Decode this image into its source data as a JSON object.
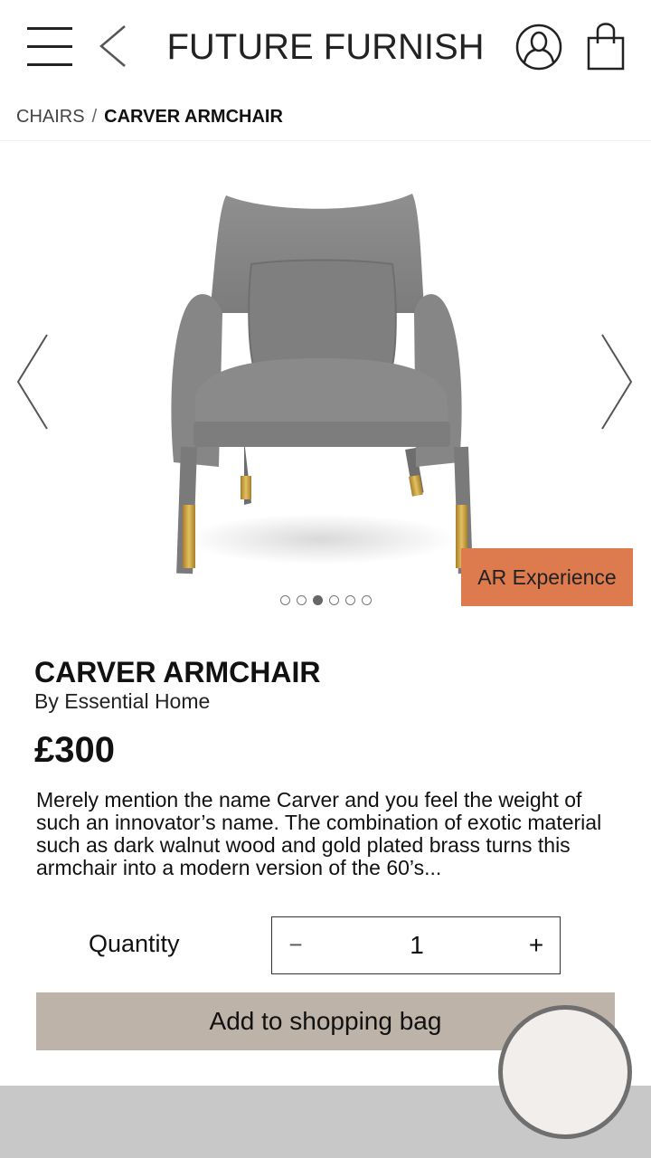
{
  "header": {
    "brand": "FUTURE FURNISH",
    "icons": {
      "menu": "hamburger-menu-icon",
      "back": "chevron-left-icon",
      "account": "user-icon",
      "bag": "shopping-bag-icon"
    }
  },
  "breadcrumb": {
    "parent": "CHAIRS",
    "separator": "/",
    "current": "CARVER ARMCHAIR"
  },
  "gallery": {
    "image": "grey-armchair",
    "ar_button": "AR Experience",
    "dots_total": 6,
    "active_index": 2,
    "colors": {
      "ar_button": "#dd7a4e",
      "fabric": "#8a8a8a",
      "brass": "#c9a042"
    }
  },
  "product": {
    "name": "CARVER ARMCHAIR",
    "brand": "By Essential Home",
    "price": "£300",
    "description": "Merely mention the name Carver and you feel the weight of such an innovator’s name. The combination of exotic material such as dark walnut wood and gold plated brass turns this armchair into a modern version of the 60’s..."
  },
  "purchase": {
    "quantity_label": "Quantity",
    "minus": "−",
    "quantity": "1",
    "plus": "+",
    "add_button": "Add to shopping bag",
    "colors": {
      "add_button": "#beb3a8"
    }
  }
}
